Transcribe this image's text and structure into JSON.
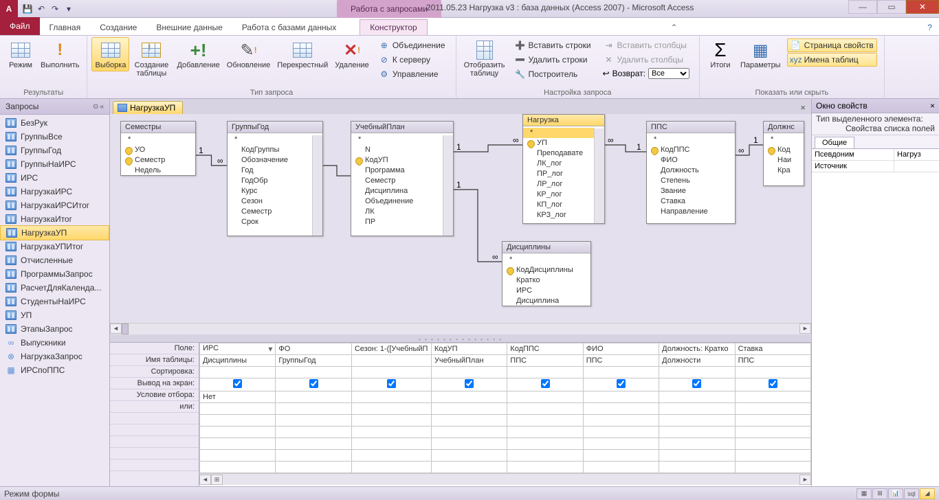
{
  "titlebar": {
    "context_tab": "Работа с запросами",
    "title": "2011.05.23 Нагрузка v3 : база данных (Access 2007) - Microsoft Access"
  },
  "ribbon_tabs": [
    "Главная",
    "Создание",
    "Внешние данные",
    "Работа с базами данных"
  ],
  "file_tab": "Файл",
  "context_ribbon_tab": "Конструктор",
  "ribbon": {
    "results": {
      "label": "Результаты",
      "mode": "Режим",
      "run": "Выполнить"
    },
    "query_type": {
      "label": "Тип запроса",
      "select": "Выборка",
      "maketable": "Создание таблицы",
      "append": "Добавление",
      "update": "Обновление",
      "crosstab": "Перекрестный",
      "delete": "Удаление",
      "union": "Объединение",
      "passthrough": "К серверу",
      "datadef": "Управление"
    },
    "setup": {
      "label": "Настройка запроса",
      "showtable": "Отобразить таблицу",
      "insrows": "Вставить строки",
      "delrows": "Удалить строки",
      "builder": "Построитель",
      "inscols": "Вставить столбцы",
      "delcols": "Удалить столбцы",
      "return": "Возврат:",
      "return_val": "Все"
    },
    "showhide": {
      "label": "Показать или скрыть",
      "totals": "Итоги",
      "params": "Параметры",
      "propsheet": "Страница свойств",
      "tablenames": "Имена таблиц"
    }
  },
  "nav": {
    "header": "Запросы",
    "items": [
      "БезРук",
      "ГруппыВсе",
      "ГруппыГод",
      "ГруппыНаИРС",
      "ИРС",
      "НагрузкаИРС",
      "НагрузкаИРСИтог",
      "НагрузкаИтог",
      "НагрузкаУП",
      "НагрузкаУПИтог",
      "Отчисленные",
      "ПрограммыЗапрос",
      "РасчетДляКаленда...",
      "СтудентыНаИРС",
      "УП",
      "ЭтапыЗапрос",
      "Выпускники",
      "НагрузкаЗапрос",
      "ИРСпоППС"
    ],
    "selected": "НагрузкаУП",
    "special_from": 16
  },
  "doc_tab": "НагрузкаУП",
  "tables": {
    "semestry": {
      "title": "Семестры",
      "fields": [
        "*",
        "УО",
        "Семестр",
        "Недель"
      ],
      "keys": [
        1,
        2
      ]
    },
    "gruppygod": {
      "title": "ГруппыГод",
      "fields": [
        "*",
        "КодГруппы",
        "Обозначение",
        "Год",
        "ГодОбр",
        "Курс",
        "Сезон",
        "Семестр",
        "Срок"
      ]
    },
    "uchplan": {
      "title": "УчебныйПлан",
      "fields": [
        "*",
        "N",
        "КодУП",
        "Программа",
        "Семестр",
        "Дисциплина",
        "Объединение",
        "ЛК",
        "ПР"
      ],
      "keys": [
        2
      ]
    },
    "nagruzka": {
      "title": "Нагрузка",
      "fields": [
        "*",
        "УП",
        "Преподавате",
        "ЛК_лог",
        "ПР_лог",
        "ЛР_лог",
        "КР_лог",
        "КП_лог",
        "КРЗ_лог"
      ],
      "keys": [
        1
      ],
      "selected": true,
      "selrow": 0
    },
    "pps": {
      "title": "ППС",
      "fields": [
        "*",
        "КодППС",
        "ФИО",
        "Должность",
        "Степень",
        "Звание",
        "Ставка",
        "Направление"
      ],
      "keys": [
        1
      ]
    },
    "dolzh": {
      "title": "Должнс",
      "fields": [
        "*",
        "Код",
        "Наи",
        "Кра"
      ],
      "keys": [
        1
      ]
    },
    "disc": {
      "title": "Дисциплины",
      "fields": [
        "*",
        "КодДисциплины",
        "Кратко",
        "ИРС",
        "Дисциплина"
      ],
      "keys": [
        1
      ]
    }
  },
  "grid": {
    "labels": [
      "Поле:",
      "Имя таблицы:",
      "Сортировка:",
      "Вывод на экран:",
      "Условие отбора:",
      "или:"
    ],
    "cols": [
      {
        "field": "ИРС",
        "table": "Дисциплины",
        "show": true,
        "crit": "Нет",
        "active": true
      },
      {
        "field": "ФО",
        "table": "ГруппыГод",
        "show": true
      },
      {
        "field": "Сезон: 1-([УчебныйП",
        "table": "",
        "show": true
      },
      {
        "field": "КодУП",
        "table": "УчебныйПлан",
        "show": true
      },
      {
        "field": "КодППС",
        "table": "ППС",
        "show": true
      },
      {
        "field": "ФИО",
        "table": "ППС",
        "show": true
      },
      {
        "field": "Должность: Кратко",
        "table": "Должности",
        "show": true
      },
      {
        "field": "Ставка",
        "table": "ППС",
        "show": true
      }
    ]
  },
  "propsheet": {
    "title": "Окно свойств",
    "subtitle": "Тип выделенного элемента:",
    "subtitle2": "Свойства списка полей",
    "tab": "Общие",
    "rows": [
      {
        "k": "Псевдоним",
        "v": "Нагруз"
      },
      {
        "k": "Источник",
        "v": ""
      }
    ]
  },
  "statusbar": "Режим формы"
}
